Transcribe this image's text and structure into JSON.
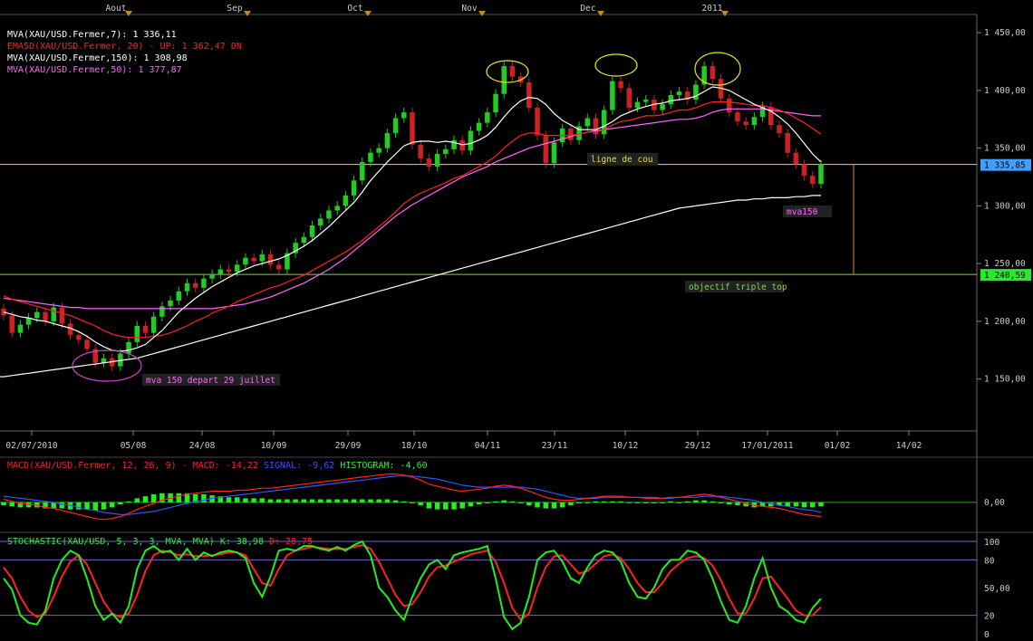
{
  "chart_data": {
    "type": "candlestick",
    "symbol": "XAU/USD",
    "months": [
      "Aout",
      "Sep",
      "Oct",
      "Nov",
      "Dec",
      "2011"
    ],
    "date_ticks": [
      "02/07/2010",
      "05/08",
      "24/08",
      "10/09",
      "29/09",
      "18/10",
      "04/11",
      "23/11",
      "10/12",
      "29/12",
      "17/01/2011",
      "01/02",
      "14/02"
    ],
    "price_axis": {
      "ylim": [
        1105,
        1465
      ],
      "ticks": [
        "1 450,00",
        "1 400,00",
        "1 350,00",
        "1 300,00",
        "1 250,00",
        "1 200,00",
        "1 150,00"
      ],
      "tick_values": [
        1450,
        1400,
        1350,
        1300,
        1250,
        1200,
        1150
      ]
    },
    "legend": [
      {
        "text": "MVA(XAU/USD.Fermer,7): 1 336,11",
        "color": "#ffffff"
      },
      {
        "text": "EMA5D(XAU/USD.Fermer, 20) - UP: 1 362,47  DN",
        "color": "#ff2222"
      },
      {
        "text": "MVA(XAU/USD.Fermer,150): 1 308,98",
        "color": "#ffffff"
      },
      {
        "text": "MVA(XAU/USD.Fermer,50): 1 377,87",
        "color": "#ff66ff"
      }
    ],
    "price_markers": [
      {
        "label": "1 335,85",
        "value": 1335.85,
        "color": "#3fa0ff"
      },
      {
        "label": "1 240,59",
        "value": 1240.59,
        "color": "#22ee22"
      }
    ],
    "annotations": {
      "neckline": "ligne de cou",
      "target": "objectif triple top",
      "mva150": "mva150",
      "mva150_start": "mva 150 depart 29 juillet"
    },
    "close": [
      1205,
      1190,
      1197,
      1203,
      1208,
      1200,
      1212,
      1198,
      1188,
      1184,
      1176,
      1164,
      1168,
      1161,
      1172,
      1182,
      1196,
      1190,
      1204,
      1213,
      1218,
      1226,
      1233,
      1229,
      1237,
      1241,
      1245,
      1243,
      1249,
      1255,
      1252,
      1258,
      1249,
      1245,
      1259,
      1268,
      1273,
      1283,
      1289,
      1296,
      1300,
      1309,
      1322,
      1338,
      1346,
      1350,
      1363,
      1376,
      1381,
      1353,
      1341,
      1334,
      1345,
      1349,
      1357,
      1348,
      1365,
      1372,
      1381,
      1397,
      1421,
      1412,
      1407,
      1385,
      1361,
      1337,
      1355,
      1367,
      1357,
      1369,
      1376,
      1362,
      1383,
      1408,
      1402,
      1385,
      1390,
      1392,
      1383,
      1388,
      1396,
      1399,
      1392,
      1405,
      1421,
      1410,
      1393,
      1381,
      1373,
      1370,
      1377,
      1386,
      1370,
      1363,
      1346,
      1336,
      1326,
      1319,
      1336
    ],
    "sma7": [
      1208,
      1206,
      1204,
      1203,
      1201,
      1200,
      1198,
      1196,
      1194,
      1191,
      1187,
      1182,
      1178,
      1175,
      1174,
      1175,
      1177,
      1180,
      1186,
      1192,
      1200,
      1208,
      1214,
      1220,
      1225,
      1230,
      1234,
      1238,
      1242,
      1245,
      1248,
      1250,
      1252,
      1254,
      1257,
      1261,
      1265,
      1270,
      1276,
      1282,
      1289,
      1296,
      1303,
      1312,
      1322,
      1330,
      1338,
      1345,
      1352,
      1355,
      1356,
      1356,
      1355,
      1356,
      1355,
      1353,
      1354,
      1357,
      1361,
      1368,
      1377,
      1385,
      1391,
      1394,
      1393,
      1388,
      1380,
      1374,
      1370,
      1366,
      1366,
      1366,
      1369,
      1373,
      1378,
      1381,
      1384,
      1386,
      1388,
      1389,
      1391,
      1392,
      1393,
      1395,
      1399,
      1403,
      1402,
      1400,
      1396,
      1392,
      1388,
      1385,
      1382,
      1377,
      1371,
      1363,
      1354,
      1345,
      1338
    ],
    "ema20": [
      1222,
      1219,
      1217,
      1215,
      1213,
      1211,
      1209,
      1207,
      1205,
      1202,
      1199,
      1196,
      1192,
      1189,
      1187,
      1186,
      1186,
      1186,
      1187,
      1188,
      1190,
      1193,
      1196,
      1200,
      1203,
      1207,
      1210,
      1213,
      1217,
      1220,
      1223,
      1226,
      1229,
      1231,
      1234,
      1237,
      1240,
      1244,
      1248,
      1252,
      1256,
      1260,
      1265,
      1270,
      1276,
      1282,
      1288,
      1295,
      1302,
      1307,
      1311,
      1314,
      1317,
      1320,
      1324,
      1326,
      1330,
      1334,
      1338,
      1343,
      1350,
      1356,
      1361,
      1363,
      1363,
      1361,
      1361,
      1361,
      1361,
      1362,
      1364,
      1364,
      1366,
      1370,
      1373,
      1374,
      1376,
      1378,
      1378,
      1379,
      1381,
      1383,
      1383,
      1385,
      1388,
      1390,
      1390,
      1390,
      1389,
      1388,
      1387,
      1387,
      1385,
      1383,
      1380,
      1376,
      1372,
      1367,
      1362
    ],
    "sma50": [
      1220,
      1219,
      1218,
      1217,
      1216,
      1215,
      1214,
      1213,
      1212,
      1212,
      1211,
      1211,
      1211,
      1211,
      1211,
      1211,
      1211,
      1211,
      1211,
      1211,
      1211,
      1211,
      1211,
      1211,
      1211,
      1211,
      1212,
      1213,
      1214,
      1215,
      1217,
      1219,
      1221,
      1224,
      1227,
      1230,
      1233,
      1237,
      1241,
      1245,
      1250,
      1255,
      1261,
      1267,
      1273,
      1279,
      1285,
      1291,
      1296,
      1301,
      1305,
      1309,
      1313,
      1317,
      1321,
      1325,
      1328,
      1331,
      1334,
      1338,
      1341,
      1344,
      1347,
      1350,
      1352,
      1354,
      1356,
      1358,
      1360,
      1362,
      1364,
      1365,
      1366,
      1367,
      1368,
      1369,
      1370,
      1371,
      1372,
      1373,
      1374,
      1375,
      1375,
      1376,
      1378,
      1381,
      1383,
      1384,
      1384,
      1384,
      1384,
      1384,
      1383,
      1382,
      1381,
      1380,
      1379,
      1378,
      1378
    ],
    "sma150": [
      1152,
      1153,
      1154,
      1155,
      1156,
      1157,
      1158,
      1159,
      1160,
      1161,
      1162,
      1163,
      1164,
      1165,
      1166,
      1167,
      1168,
      1170,
      1172,
      1174,
      1176,
      1178,
      1180,
      1182,
      1184,
      1186,
      1188,
      1190,
      1192,
      1194,
      1196,
      1198,
      1200,
      1202,
      1204,
      1206,
      1208,
      1210,
      1212,
      1214,
      1216,
      1218,
      1220,
      1222,
      1224,
      1226,
      1228,
      1230,
      1232,
      1234,
      1236,
      1238,
      1240,
      1242,
      1244,
      1246,
      1248,
      1250,
      1252,
      1254,
      1256,
      1258,
      1260,
      1262,
      1264,
      1266,
      1268,
      1270,
      1272,
      1274,
      1276,
      1278,
      1280,
      1282,
      1284,
      1286,
      1288,
      1290,
      1292,
      1294,
      1296,
      1298,
      1299,
      1300,
      1301,
      1302,
      1303,
      1304,
      1305,
      1305,
      1306,
      1306,
      1307,
      1307,
      1307,
      1308,
      1308,
      1309,
      1309
    ],
    "macd": {
      "label": "MACD(XAU/USD.Fermer, 12, 26, 9) - MACD: -14,22",
      "signal_label": "SIGNAL: -9,62",
      "hist_label": "HISTOGRAM: -4,60",
      "zero_tick": "0,00",
      "values": {
        "macd": [
          3,
          1,
          -1,
          -2,
          -3,
          -5,
          -6,
          -8,
          -10,
          -12,
          -14,
          -16,
          -17,
          -16,
          -14,
          -11,
          -7,
          -4,
          -1,
          2,
          4,
          6,
          8,
          9,
          10,
          11,
          11,
          11,
          12,
          12,
          13,
          14,
          14,
          15,
          16,
          17,
          18,
          19,
          20,
          21,
          22,
          23,
          24,
          25,
          26,
          27,
          28,
          28,
          27,
          25,
          22,
          18,
          16,
          14,
          12,
          11,
          12,
          13,
          14,
          16,
          17,
          16,
          14,
          11,
          8,
          5,
          3,
          2,
          2,
          3,
          4,
          5,
          6,
          6,
          6,
          5,
          5,
          4,
          4,
          4,
          5,
          5,
          6,
          7,
          8,
          7,
          5,
          3,
          1,
          -1,
          -3,
          -4,
          -5,
          -6,
          -8,
          -10,
          -12,
          -13,
          -14
        ],
        "signal": [
          6,
          5,
          4,
          3,
          2,
          1,
          0,
          -2,
          -3,
          -5,
          -7,
          -8,
          -10,
          -11,
          -12,
          -12,
          -11,
          -10,
          -9,
          -7,
          -5,
          -3,
          -1,
          1,
          2,
          4,
          5,
          6,
          7,
          8,
          9,
          10,
          11,
          12,
          13,
          14,
          15,
          16,
          17,
          18,
          19,
          20,
          21,
          22,
          23,
          24,
          25,
          26,
          26,
          26,
          25,
          24,
          23,
          21,
          19,
          17,
          16,
          15,
          15,
          15,
          15,
          15,
          15,
          14,
          13,
          11,
          9,
          7,
          5,
          4,
          4,
          4,
          5,
          5,
          5,
          5,
          5,
          5,
          5,
          4,
          4,
          5,
          5,
          5,
          6,
          6,
          6,
          5,
          4,
          3,
          2,
          0,
          -1,
          -3,
          -4,
          -6,
          -7,
          -8,
          -10
        ]
      },
      "ylim": [
        -27,
        33
      ]
    },
    "stochastic": {
      "label": "STOCHASTIC(XAU/USD, 5, 3, 3, MVA, MVA)",
      "k_label": "K: 38,98",
      "d_label": "D: 28,75",
      "ticks": [
        "100",
        "80",
        "50,00",
        "20",
        "0"
      ],
      "tick_values": [
        100,
        80,
        50,
        20,
        0
      ],
      "k": [
        60,
        48,
        20,
        12,
        10,
        25,
        60,
        80,
        90,
        85,
        60,
        30,
        15,
        22,
        12,
        30,
        70,
        90,
        95,
        88,
        90,
        80,
        92,
        80,
        88,
        84,
        88,
        90,
        88,
        82,
        55,
        40,
        62,
        90,
        92,
        90,
        95,
        95,
        92,
        90,
        94,
        90,
        96,
        100,
        85,
        50,
        40,
        25,
        15,
        40,
        60,
        75,
        80,
        70,
        85,
        88,
        90,
        92,
        95,
        60,
        18,
        5,
        12,
        40,
        80,
        88,
        90,
        78,
        60,
        55,
        72,
        85,
        90,
        88,
        78,
        55,
        40,
        38,
        50,
        70,
        80,
        80,
        90,
        88,
        80,
        60,
        35,
        15,
        12,
        30,
        60,
        82,
        50,
        30,
        24,
        15,
        12,
        28,
        38
      ],
      "d": [
        72,
        60,
        40,
        25,
        18,
        22,
        40,
        62,
        78,
        85,
        75,
        55,
        35,
        22,
        18,
        22,
        42,
        68,
        85,
        90,
        88,
        85,
        86,
        84,
        84,
        85,
        86,
        88,
        88,
        85,
        70,
        55,
        52,
        70,
        85,
        90,
        92,
        94,
        93,
        92,
        92,
        92,
        94,
        96,
        92,
        78,
        60,
        42,
        30,
        32,
        45,
        62,
        72,
        74,
        78,
        82,
        86,
        88,
        90,
        78,
        55,
        28,
        15,
        22,
        50,
        72,
        84,
        85,
        75,
        65,
        68,
        76,
        84,
        86,
        82,
        70,
        55,
        45,
        45,
        55,
        68,
        76,
        82,
        84,
        82,
        74,
        58,
        38,
        22,
        22,
        38,
        60,
        62,
        50,
        38,
        25,
        20,
        20,
        29
      ]
    }
  }
}
